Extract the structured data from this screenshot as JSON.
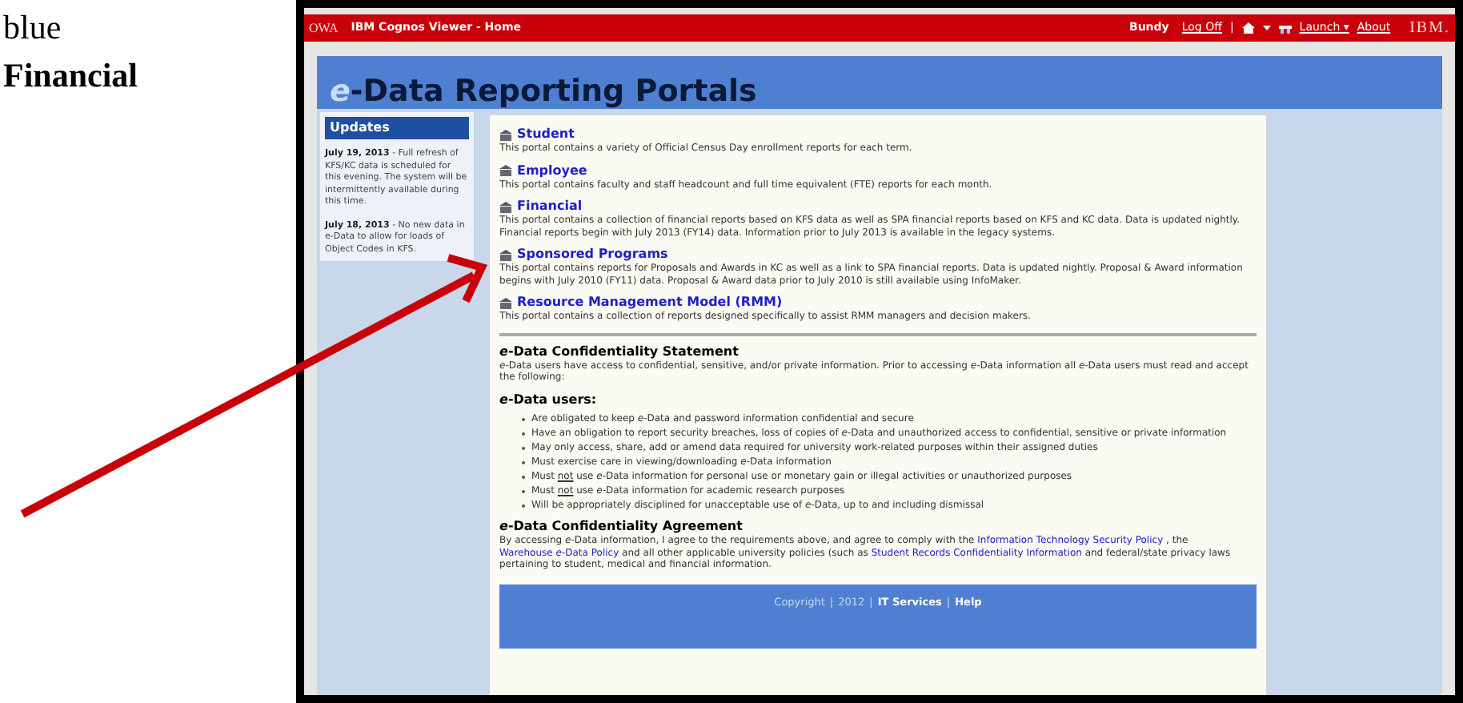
{
  "document_text": [
    {
      "text": "blue",
      "bold": false
    },
    {
      "text": "Financial",
      "bold": true
    }
  ],
  "app_bar": {
    "brand": "OWA",
    "title": "IBM Cognos Viewer - Home",
    "user": "Bundy",
    "links": [
      {
        "kind": "link",
        "text": "Log Off"
      },
      {
        "kind": "separator",
        "text": "|"
      },
      {
        "kind": "home"
      },
      {
        "kind": "caret"
      },
      {
        "kind": "launch-icon"
      },
      {
        "kind": "link",
        "text": "Launch ▾"
      },
      {
        "kind": "link",
        "text": "About"
      }
    ],
    "logo": "IBM."
  },
  "header": {
    "parts": [
      {
        "text": "e",
        "accent": true
      },
      {
        "text": "-Data Reporting Portals",
        "accent": false
      }
    ]
  },
  "updates": {
    "title": "Updates",
    "items": [
      {
        "date": "July 19, 2013",
        "text": " - Full refresh of KFS/KC data is scheduled for this evening. The system will be intermittently available during this time."
      },
      {
        "date": "July 18, 2013",
        "text": " - No new data in e-Data to allow for loads of Object Codes in KFS."
      }
    ]
  },
  "portals": [
    {
      "title": "Student",
      "description": "This portal contains a variety of Official Census Day enrollment reports for each term."
    },
    {
      "title": "Employee",
      "description": "This portal contains faculty and staff headcount and full time equivalent (FTE) reports for each month."
    },
    {
      "title": "Financial",
      "description": "This portal contains a collection of financial reports based on KFS data as well as SPA financial reports based on KFS and KC data. Data is updated nightly. Financial reports begin with July 2013 (FY14) data. Information prior to July 2013 is available in the legacy systems."
    },
    {
      "title": "Sponsored Programs",
      "description": "This portal contains reports for Proposals and Awards in KC as well as a link to SPA financial reports. Data is updated nightly. Proposal & Award information begins with July 2010 (FY11) data. Proposal & Award data prior to July 2010 is still available using InfoMaker."
    },
    {
      "title": "Resource Management Model (RMM)",
      "description": "This portal contains a collection of reports designed specifically to assist RMM managers and decision makers."
    }
  ],
  "statement": {
    "title": "*e*-Data Confidentiality Statement",
    "text": "*e*-Data users have access to confidential, sensitive, and/or private information. Prior to accessing *e*-Data information all *e*-Data users must read and accept the following:"
  },
  "users": {
    "title": "*e*-Data users:",
    "bullets": [
      {
        "parts": [
          {
            "text": "Are obligated to keep *e*-Data and password information confidential and secure",
            "underline": false
          }
        ]
      },
      {
        "parts": [
          {
            "text": "Have an obligation to report security breaches, loss of copies of *e*-Data and unauthorized access to confidential, sensitive or private information",
            "underline": false
          }
        ]
      },
      {
        "parts": [
          {
            "text": "May only access, share, add or amend data required for university work-related purposes within their assigned duties",
            "underline": false
          }
        ]
      },
      {
        "parts": [
          {
            "text": "Must exercise care in viewing/downloading *e*-Data information",
            "underline": false
          }
        ]
      },
      {
        "parts": [
          {
            "text": "Must ",
            "underline": false
          },
          {
            "text": "not",
            "underline": true
          },
          {
            "text": " use *e*-Data information for personal use or monetary gain or illegal activities or unauthorized purposes",
            "underline": false
          }
        ]
      },
      {
        "parts": [
          {
            "text": "Must ",
            "underline": false
          },
          {
            "text": "not",
            "underline": true
          },
          {
            "text": " use *e*-Data information for academic research purposes",
            "underline": false
          }
        ]
      },
      {
        "parts": [
          {
            "text": "Will be appropriately disciplined for unacceptable use of *e*-Data, up to and including dismissal",
            "underline": false
          }
        ]
      }
    ]
  },
  "agreement": {
    "title": "*e*-Data Confidentiality Agreement",
    "parts": [
      {
        "text": "By accessing *e*-Data information, I agree to the requirements above, and agree to comply with the ",
        "link": false
      },
      {
        "text": "Information Technology Security Policy",
        "link": true
      },
      {
        "text": " , the ",
        "link": false
      },
      {
        "text": "Warehouse *e*-Data Policy",
        "link": true
      },
      {
        "text": " and all other applicable university policies (such as ",
        "link": false
      },
      {
        "text": "Student Records Confidentiality Information",
        "link": true
      },
      {
        "text": " and federal/state privacy laws pertaining to student, medical and financial information.",
        "link": false
      }
    ]
  },
  "footer": [
    {
      "text": "Copyright",
      "link": false
    },
    {
      "text": "|",
      "link": false
    },
    {
      "text": "2012",
      "link": false
    },
    {
      "text": "|",
      "link": false
    },
    {
      "text": "IT Services",
      "link": true
    },
    {
      "text": "|",
      "link": false
    },
    {
      "text": "Help",
      "link": true
    }
  ]
}
